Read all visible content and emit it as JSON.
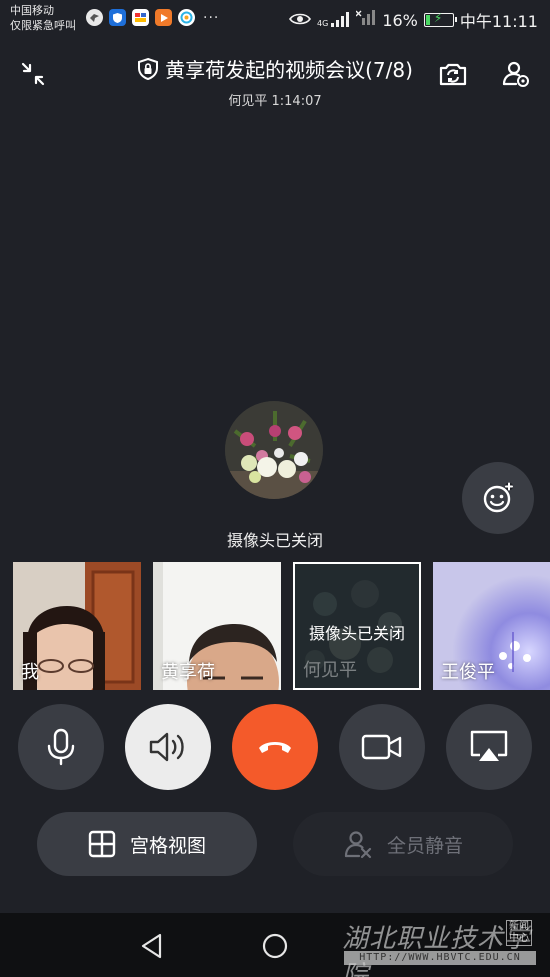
{
  "status_bar": {
    "carrier_line1": "中国移动",
    "carrier_line2": "仅限紧急呼叫",
    "more": "···",
    "network": "4G",
    "battery_percent": "16%",
    "battery_level": 0.16,
    "time": "中午11:11",
    "notification_icons": [
      "bird-app-icon",
      "shield-app-icon",
      "video-app-icon",
      "play-app-icon",
      "camera-app-icon"
    ]
  },
  "header": {
    "title": "黄享荷发起的视频会议(7/8)",
    "subtitle": "何见平 1:14:07",
    "minimize_icon": "collapse-icon",
    "flip_camera_icon": "camera-switch-icon",
    "participants_icon": "participant-settings-icon"
  },
  "center": {
    "avatar": "flowers-avatar",
    "camera_off_label": "摄像头已关闭"
  },
  "participants": [
    {
      "name": "我",
      "camera_off": false
    },
    {
      "name": "黄享荷",
      "camera_off": false
    },
    {
      "name": "何见平",
      "camera_off": true,
      "overlay": "摄像头已关闭"
    },
    {
      "name": "王俊平",
      "camera_off": false
    }
  ],
  "controls": {
    "mic_icon": "microphone-icon",
    "speaker_icon": "speaker-icon",
    "hangup_icon": "hang-up-icon",
    "camera_icon": "video-camera-icon",
    "screen_share_icon": "screen-cast-icon",
    "hangup_color": "#f45a2a",
    "speaker_active_color": "#ececec"
  },
  "bottom_actions": {
    "grid_view_label": "宫格视图",
    "mute_all_label": "全员静音"
  },
  "watermark": {
    "text": "湖北职业技术学院",
    "badge_line1": "新闻",
    "badge_line2": "中心",
    "url": "HTTP://WWW.HBVTC.EDU.CN"
  }
}
